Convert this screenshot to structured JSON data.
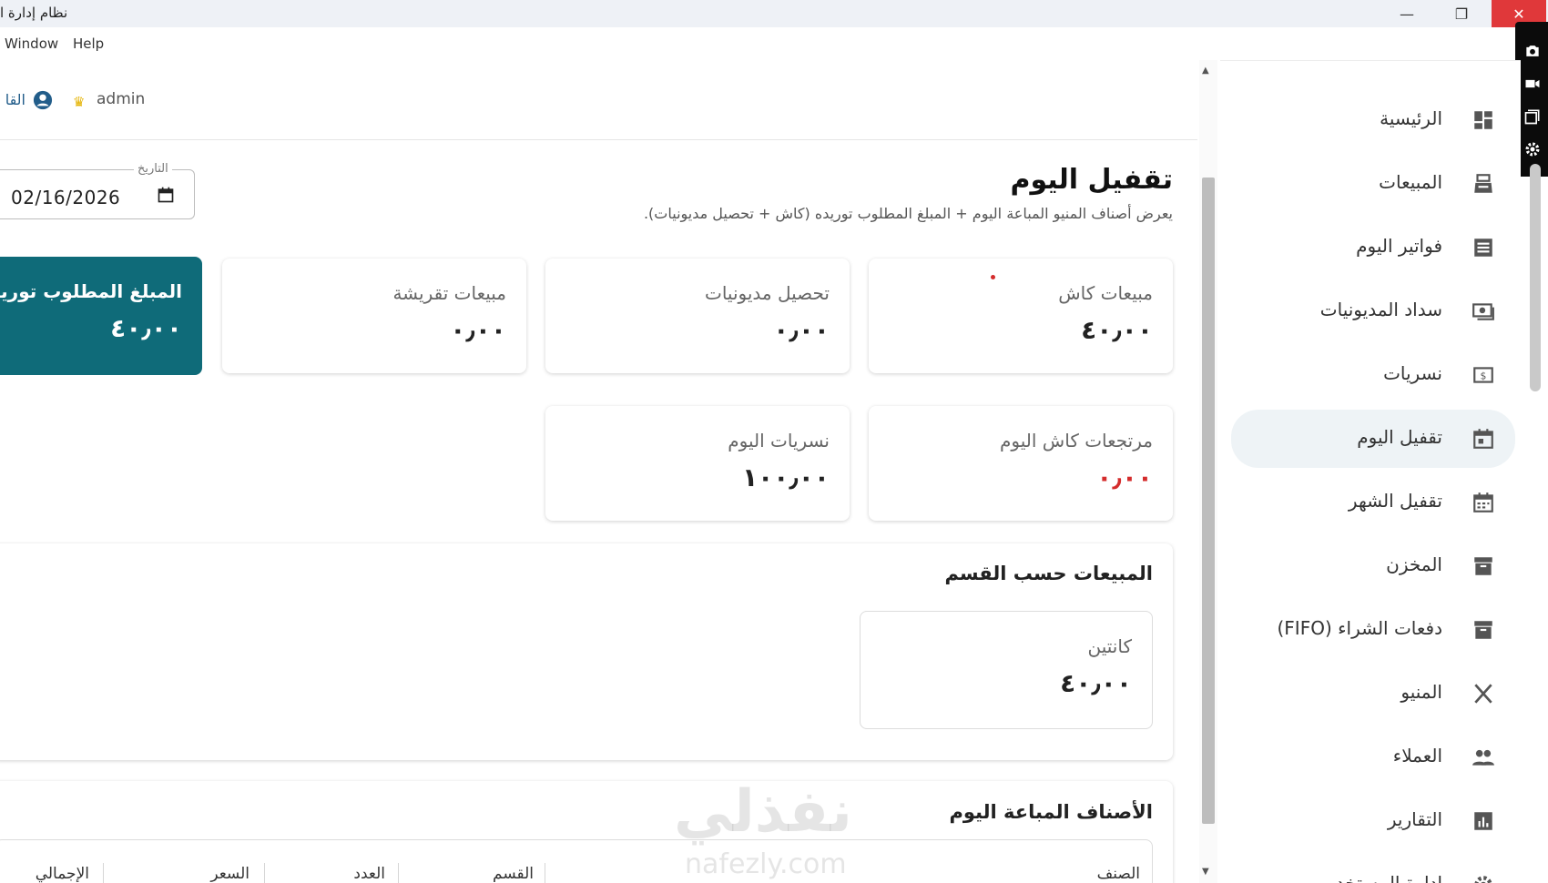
{
  "window": {
    "title": "نظام إدارة ا",
    "minimize_glyph": "—",
    "maximize_glyph": "❐",
    "close_glyph": "✕"
  },
  "menubar": {
    "items": [
      "Window",
      "Help"
    ]
  },
  "header": {
    "username": "admin",
    "cashier_label": "القا"
  },
  "page": {
    "title": "تقفيل اليوم",
    "subtitle": "يعرض أصناف المنيو المباعة اليوم + المبلغ المطلوب توريده (كاش + تحصيل مديونيات).",
    "date_label": "التاريخ",
    "date_value": "02/16/2026"
  },
  "cards": {
    "cash_sales": {
      "title": "مبيعات كاش",
      "value": "٤٠٫٠٠"
    },
    "debt_collection": {
      "title": "تحصيل مديونيات",
      "value": "٠٫٠٠"
    },
    "taqrisha_sales": {
      "title": "مبيعات تقريشة",
      "value": "٠٫٠٠"
    },
    "required_supply": {
      "title": "المبلغ المطلوب توريده",
      "value": "٤٠٫٠٠"
    },
    "cash_returns": {
      "title": "مرتجعات كاش اليوم",
      "value": "٠٫٠٠"
    },
    "expenses_today": {
      "title": "نسريات اليوم",
      "value": "١٠٠٫٠٠"
    }
  },
  "by_category": {
    "title": "المبيعات حسب القسم",
    "items": [
      {
        "name": "كانتين",
        "value": "٤٠٫٠٠"
      }
    ]
  },
  "sold_items": {
    "title": "الأصناف المباعة اليوم",
    "columns": [
      "الصنف",
      "القسم",
      "العدد",
      "السعر",
      "الإجمالي"
    ]
  },
  "sidebar": {
    "items": [
      {
        "label": "الرئيسية",
        "icon": "dashboard-icon"
      },
      {
        "label": "المبيعات",
        "icon": "cash-register-icon"
      },
      {
        "label": "فواتير اليوم",
        "icon": "receipt-icon"
      },
      {
        "label": "سداد المديونيات",
        "icon": "payment-icon"
      },
      {
        "label": "نسريات",
        "icon": "money-icon"
      },
      {
        "label": "تقفيل اليوم",
        "icon": "calendar-today-icon",
        "active": true
      },
      {
        "label": "تقفيل الشهر",
        "icon": "calendar-month-icon"
      },
      {
        "label": "المخزن",
        "icon": "archive-icon"
      },
      {
        "label": "دفعات الشراء (FIFO)",
        "icon": "inventory-icon"
      },
      {
        "label": "المنيو",
        "icon": "utensils-icon"
      },
      {
        "label": "العملاء",
        "icon": "people-icon"
      },
      {
        "label": "التقارير",
        "icon": "bar-chart-icon"
      },
      {
        "label": "إدارة المستخدمين",
        "icon": "settings-icon"
      }
    ]
  },
  "watermark": {
    "text": "نفذلي",
    "url": "nafezly.com"
  },
  "colors": {
    "accent": "#0f6b79",
    "negative": "#d42c2c",
    "active_nav": "#eef3f6"
  }
}
